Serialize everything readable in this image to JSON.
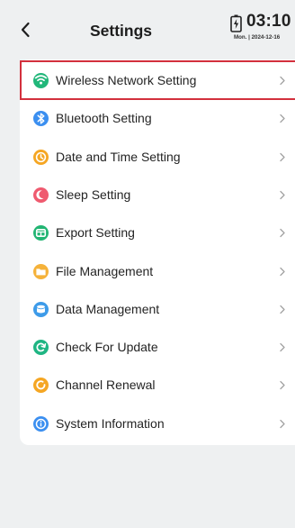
{
  "header": {
    "back_label": "<",
    "title": "Settings"
  },
  "status": {
    "time": "03:10",
    "date": "Mon. | 2024-12-16"
  },
  "menu": [
    {
      "label": "Wireless Network Setting",
      "icon": "wifi-icon",
      "color": "#21b77a",
      "selected": true
    },
    {
      "label": "Bluetooth Setting",
      "icon": "bluetooth-icon",
      "color": "#3b8ff0"
    },
    {
      "label": "Date and Time Setting",
      "icon": "clock-icon",
      "color": "#f5a623"
    },
    {
      "label": "Sleep Setting",
      "icon": "sleep-icon",
      "color": "#ef5a6f"
    },
    {
      "label": "Export Setting",
      "icon": "export-icon",
      "color": "#22b573"
    },
    {
      "label": "File Management",
      "icon": "folder-icon",
      "color": "#f5b23a"
    },
    {
      "label": "Data Management",
      "icon": "data-icon",
      "color": "#3d9be9"
    },
    {
      "label": "Check For Update",
      "icon": "update-icon",
      "color": "#1fb583"
    },
    {
      "label": "Channel Renewal",
      "icon": "renew-icon",
      "color": "#f5a623"
    },
    {
      "label": "System Information",
      "icon": "info-icon",
      "color": "#3b8ff0"
    }
  ],
  "colors": {
    "background": "#eef0f1",
    "card": "#ffffff",
    "selection_border": "#d3303d",
    "chevron": "#a3a3a3"
  }
}
